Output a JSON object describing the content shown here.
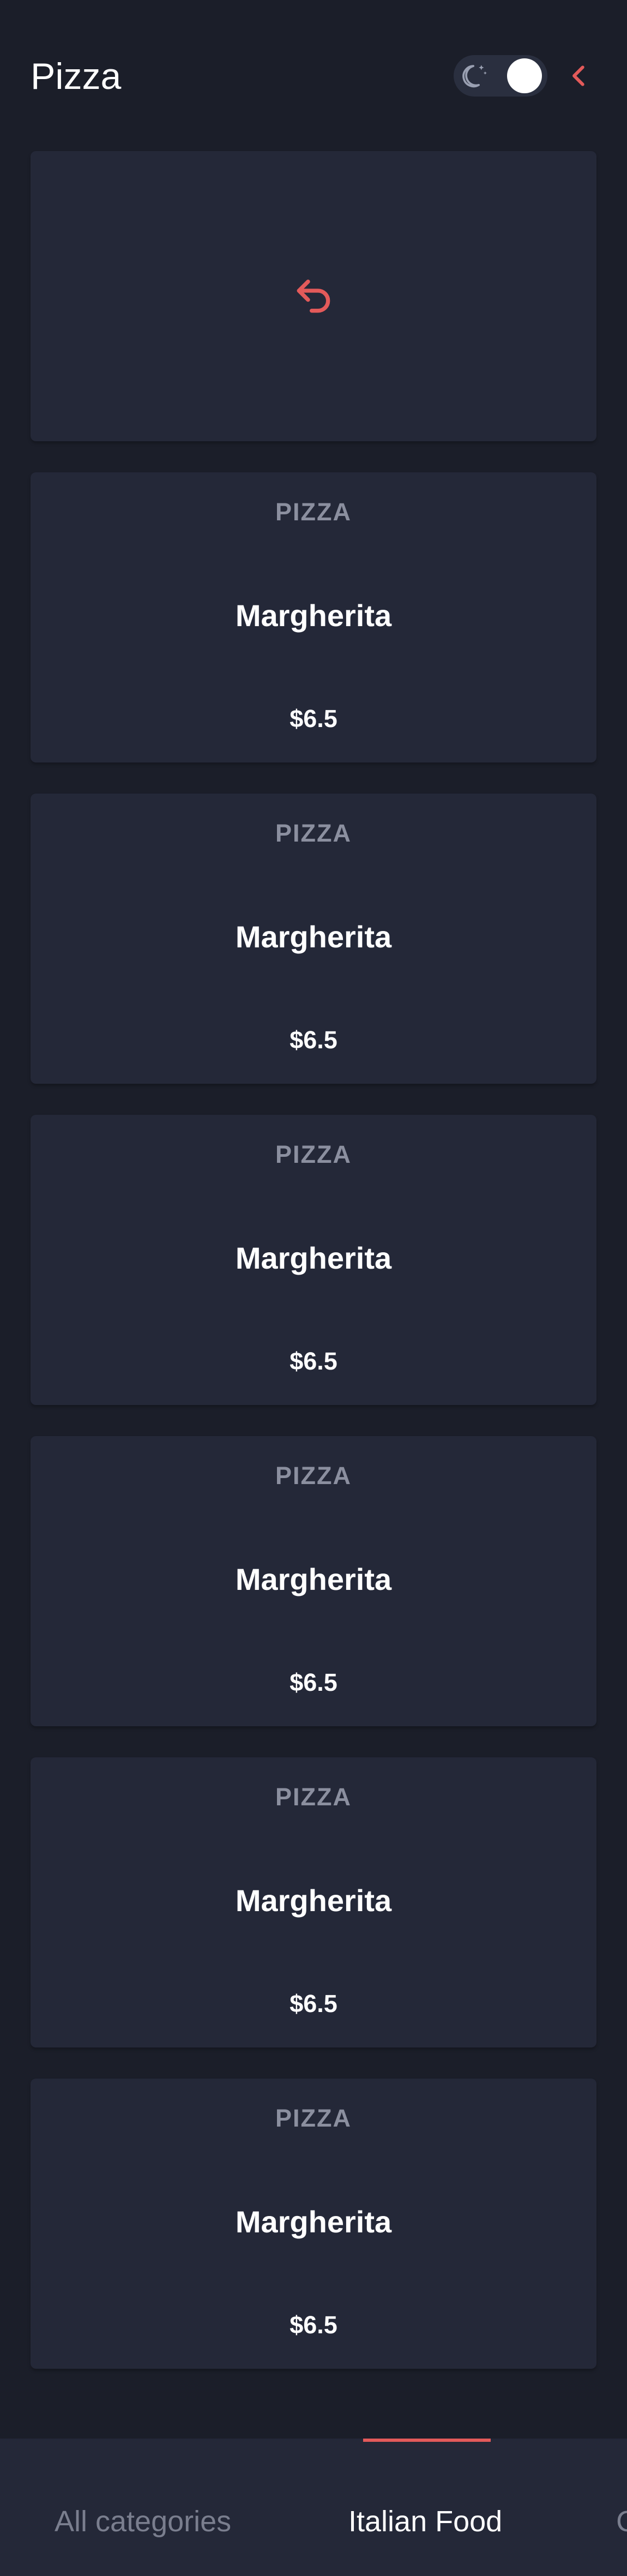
{
  "header": {
    "title": "Pizza",
    "theme_toggle": {
      "icon": "moon-icon",
      "state": "on"
    },
    "back_icon": "chevron-left-icon"
  },
  "colors": {
    "background": "#1b1e29",
    "card": "#242838",
    "accent": "#e35a5a",
    "muted_text": "#8b8f9f",
    "inactive_tab_text": "#7a7e8e"
  },
  "undo_card": {
    "icon": "undo-icon"
  },
  "items": [
    {
      "category": "PIZZA",
      "name": "Margherita",
      "price": "$6.5"
    },
    {
      "category": "PIZZA",
      "name": "Margherita",
      "price": "$6.5"
    },
    {
      "category": "PIZZA",
      "name": "Margherita",
      "price": "$6.5"
    },
    {
      "category": "PIZZA",
      "name": "Margherita",
      "price": "$6.5"
    },
    {
      "category": "PIZZA",
      "name": "Margherita",
      "price": "$6.5"
    },
    {
      "category": "PIZZA",
      "name": "Margherita",
      "price": "$6.5"
    }
  ],
  "bottom_nav": {
    "tabs": [
      {
        "label": "All categories",
        "active": false
      },
      {
        "label": "Italian Food",
        "active": true
      },
      {
        "label": "C",
        "active": false
      }
    ]
  }
}
